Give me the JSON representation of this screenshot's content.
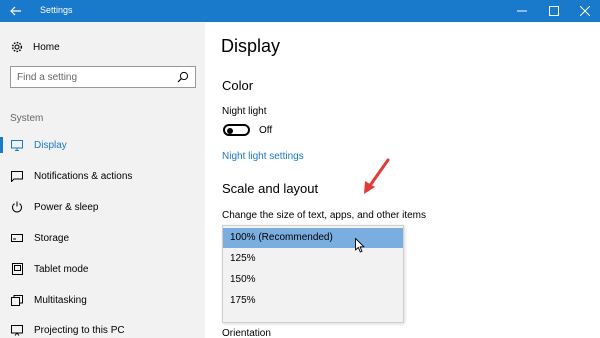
{
  "window": {
    "title": "Settings"
  },
  "colors": {
    "accent": "#1979ca",
    "sidebar_bg": "#f2f2f2",
    "selected_option": "#7aaee0",
    "annotation_arrow": "#e03a3a"
  },
  "sidebar": {
    "home_label": "Home",
    "search_placeholder": "Find a setting",
    "section_label": "System",
    "items": [
      {
        "label": "Display",
        "icon": "monitor-icon",
        "active": true
      },
      {
        "label": "Notifications & actions",
        "icon": "notification-icon",
        "active": false
      },
      {
        "label": "Power & sleep",
        "icon": "power-icon",
        "active": false
      },
      {
        "label": "Storage",
        "icon": "storage-icon",
        "active": false
      },
      {
        "label": "Tablet mode",
        "icon": "tablet-icon",
        "active": false
      },
      {
        "label": "Multitasking",
        "icon": "multitasking-icon",
        "active": false
      },
      {
        "label": "Projecting to this PC",
        "icon": "projecting-icon",
        "active": false
      }
    ]
  },
  "main": {
    "title": "Display",
    "color_heading": "Color",
    "night_light_label": "Night light",
    "night_light_state": "Off",
    "night_light_link": "Night light settings",
    "scale_heading": "Scale and layout",
    "scale_description": "Change the size of text, apps, and other items",
    "scale_options": [
      "100% (Recommended)",
      "125%",
      "150%",
      "175%"
    ],
    "scale_selected": "100% (Recommended)",
    "orientation_label": "Orientation"
  }
}
